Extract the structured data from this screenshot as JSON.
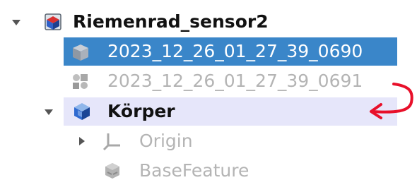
{
  "tree": {
    "sensor": {
      "label": "Riemenrad_sensor2",
      "icon": "document-icon",
      "expanded": true
    },
    "selected_item": {
      "label": "2023_12_26_01_27_39_0690",
      "icon": "gray-cube-icon",
      "selected": true
    },
    "hidden_item": {
      "label": "2023_12_26_01_27_39_0691",
      "icon": "gray-objects-icon"
    },
    "body": {
      "label": "Körper",
      "icon": "blue-body-icon",
      "expanded": true,
      "active": true
    },
    "origin": {
      "label": "Origin",
      "icon": "axes-icon",
      "expanded": false
    },
    "basefeature": {
      "label": "BaseFeature",
      "icon": "gray-feature-icon"
    }
  },
  "colors": {
    "selection_bg": "#3a86c9",
    "active_body_bg": "#e6e6fa",
    "annotation_red": "#e8102a",
    "hidden_text": "#b4b4b4"
  },
  "annotation": {
    "type": "red-curved-arrow",
    "from": "hidden_item",
    "to": "body"
  }
}
